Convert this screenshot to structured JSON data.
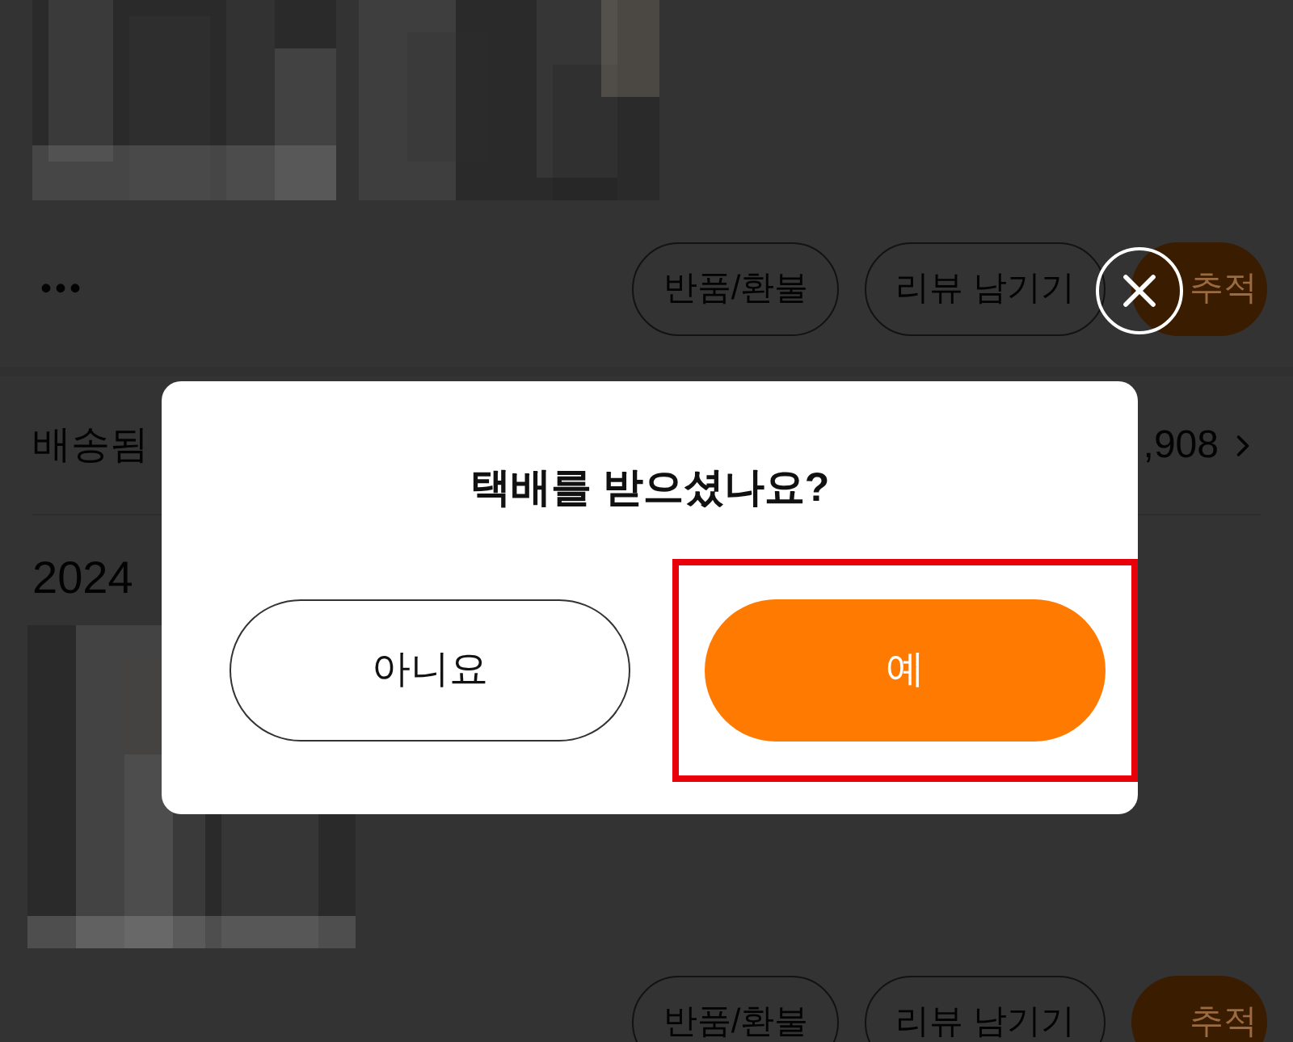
{
  "background": {
    "order_1": {
      "more": "•••",
      "actions": [
        {
          "label": "반품/환불",
          "kind": "outline"
        },
        {
          "label": "리뷰 남기기",
          "kind": "outline"
        },
        {
          "label": "추적",
          "kind": "primary"
        }
      ]
    },
    "delivery_row": {
      "status": "배송됨",
      "amount": ",908"
    },
    "order_2": {
      "date": "2024",
      "actions": [
        {
          "label": "반품/환불",
          "kind": "outline"
        },
        {
          "label": "리뷰 남기기",
          "kind": "outline"
        },
        {
          "label": "추적",
          "kind": "primary"
        }
      ]
    }
  },
  "dialog": {
    "title": "택배를 받으셨나요?",
    "buttons": [
      {
        "label": "아니요",
        "kind": "secondary",
        "highlighted": false
      },
      {
        "label": "예",
        "kind": "primary",
        "highlighted": true
      }
    ]
  }
}
